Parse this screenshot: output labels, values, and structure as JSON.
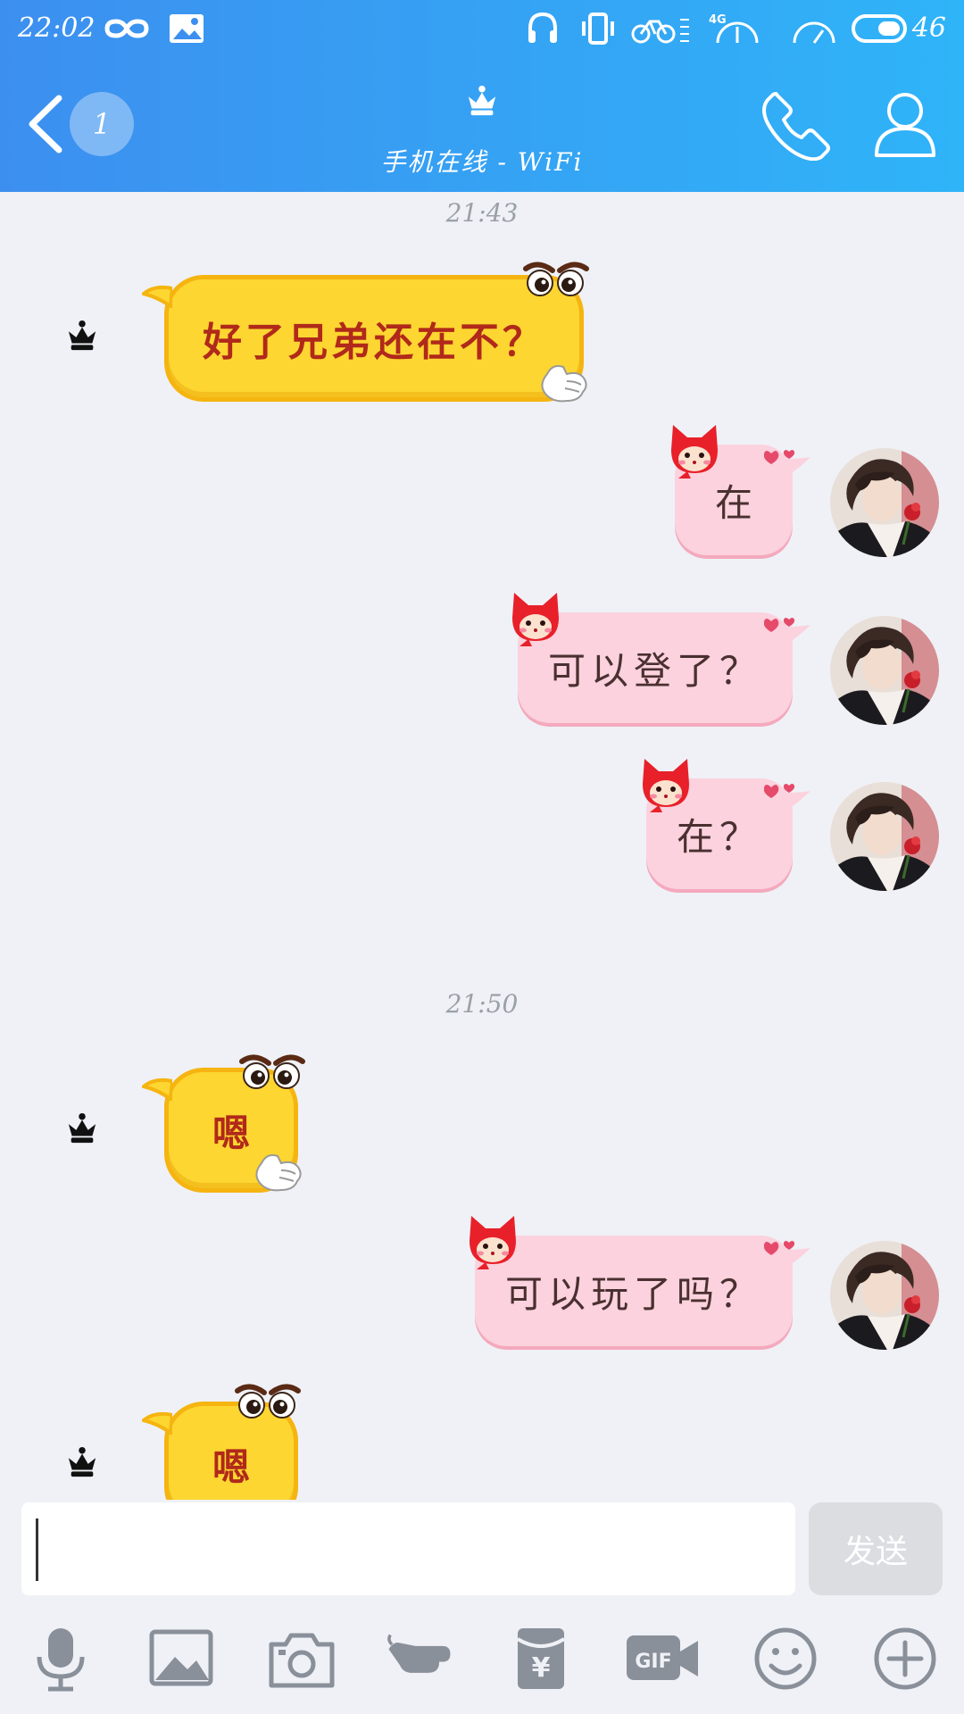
{
  "status_bar": {
    "time": "22:02",
    "battery": "46",
    "network": "4G"
  },
  "nav": {
    "back_badge": "1",
    "subtitle": "手机在线 - WiFi"
  },
  "messages": [
    {
      "type": "timestamp",
      "text": "21:43"
    },
    {
      "side": "left",
      "text": "好了兄弟还在不？"
    },
    {
      "side": "right",
      "text": "在"
    },
    {
      "side": "right",
      "text": "可以登了？"
    },
    {
      "side": "right",
      "text": "在？"
    },
    {
      "type": "timestamp",
      "text": "21:50"
    },
    {
      "side": "left",
      "text": "嗯"
    },
    {
      "side": "right",
      "text": "可以玩了吗？"
    },
    {
      "side": "left",
      "text": "嗯"
    }
  ],
  "input": {
    "value": "",
    "send_label": "发送"
  },
  "toolbar": [
    "mic-icon",
    "image-icon",
    "camera-icon",
    "poke-icon",
    "red-packet-icon",
    "gif-icon",
    "emoji-icon",
    "plus-icon"
  ],
  "colors": {
    "header_start": "#3c8fef",
    "header_end": "#2fb4f8",
    "yellow_bubble": "#fdd631",
    "pink_bubble": "#fbd2de",
    "background": "#eff1f6"
  }
}
